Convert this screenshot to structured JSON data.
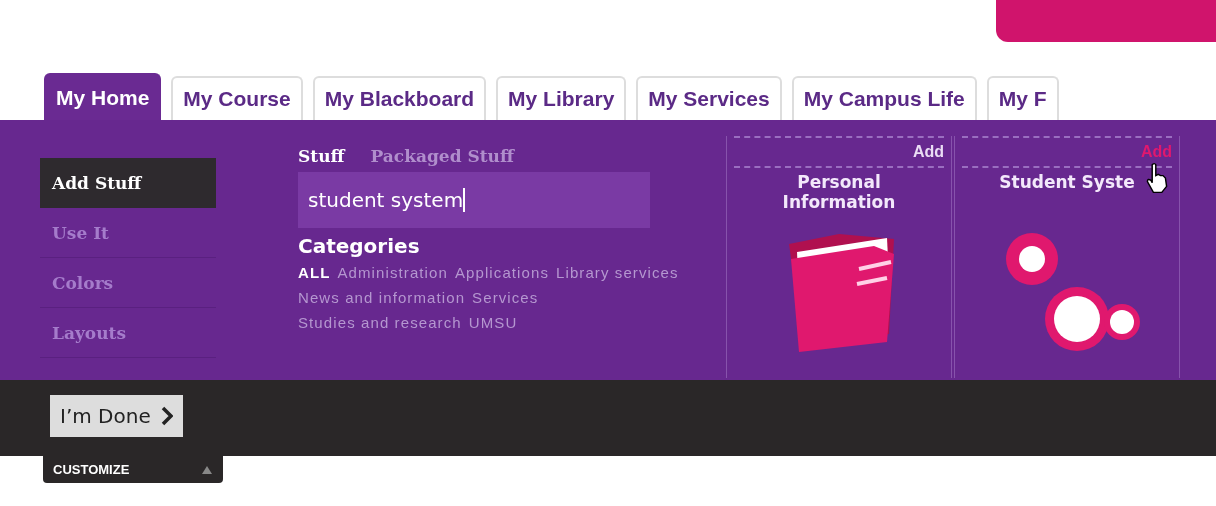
{
  "tabs": [
    {
      "label": "My Home",
      "selected": true
    },
    {
      "label": "My Course",
      "selected": false
    },
    {
      "label": "My Blackboard",
      "selected": false
    },
    {
      "label": "My Library",
      "selected": false
    },
    {
      "label": "My Services",
      "selected": false
    },
    {
      "label": "My Campus Life",
      "selected": false
    },
    {
      "label": "My F",
      "selected": false
    }
  ],
  "sidebar": {
    "items": [
      {
        "label": "Add Stuff",
        "selected": true
      },
      {
        "label": "Use It",
        "selected": false
      },
      {
        "label": "Colors",
        "selected": false
      },
      {
        "label": "Layouts",
        "selected": false
      }
    ]
  },
  "stuff_tabs": [
    {
      "label": "Stuff",
      "selected": true
    },
    {
      "label": "Packaged Stuff",
      "selected": false
    }
  ],
  "search": {
    "value": "student system"
  },
  "categories": {
    "title": "Categories",
    "items": [
      {
        "label": "ALL",
        "selected": true
      },
      {
        "label": "Administration",
        "selected": false
      },
      {
        "label": "Applications",
        "selected": false
      },
      {
        "label": "Library services",
        "selected": false
      },
      {
        "label": "News and information",
        "selected": false
      },
      {
        "label": "Services",
        "selected": false
      },
      {
        "label": "Studies and research",
        "selected": false
      },
      {
        "label": "UMSU",
        "selected": false
      }
    ]
  },
  "tiles": [
    {
      "add": "Add",
      "hovered": false,
      "title": "Personal Information",
      "kind": "folder"
    },
    {
      "add": "Add",
      "hovered": true,
      "title": "Student Syste",
      "kind": "gears"
    }
  ],
  "done_button": {
    "label": "I’m Done"
  },
  "customize_tab": {
    "label": "CUSTOMIZE"
  }
}
